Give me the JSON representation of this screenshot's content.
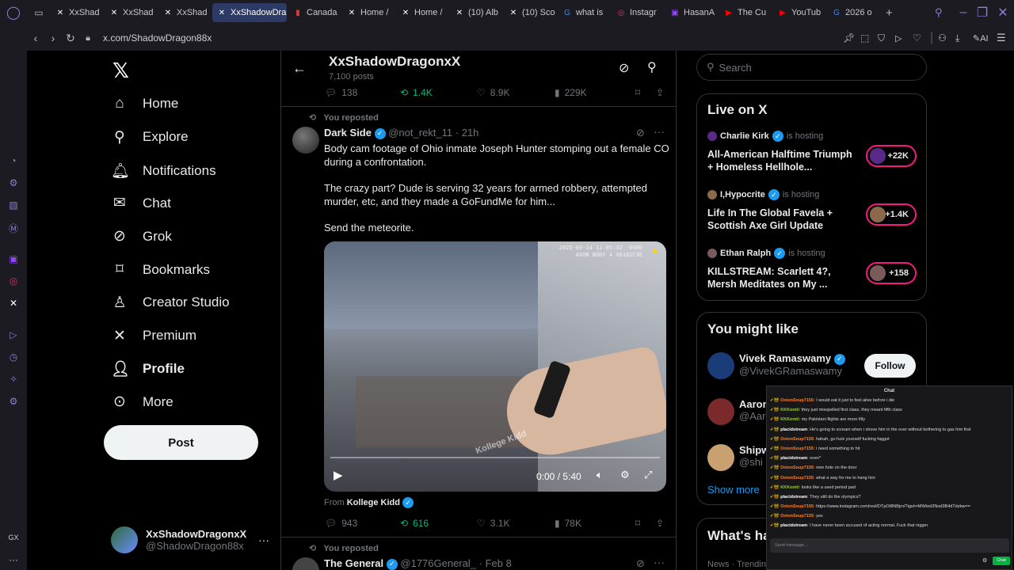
{
  "browser": {
    "tabs": [
      {
        "label": "XxShad",
        "icon": "x-logo-icon",
        "active": false
      },
      {
        "label": "XxShad",
        "icon": "x-logo-icon",
        "active": false
      },
      {
        "label": "XxShad",
        "icon": "x-logo-icon",
        "active": false
      },
      {
        "label": "XxShadowDra",
        "icon": "x-logo-icon",
        "active": true
      },
      {
        "label": "Canada",
        "icon": "bookmark-icon",
        "active": false
      },
      {
        "label": "Home /",
        "icon": "x-logo-icon",
        "active": false
      },
      {
        "label": "Home /",
        "icon": "x-logo-icon",
        "active": false
      },
      {
        "label": "(10) Alb",
        "icon": "x-logo-icon",
        "active": false
      },
      {
        "label": "(10) Sco",
        "icon": "x-logo-icon",
        "active": false
      },
      {
        "label": "what is",
        "icon": "google-icon",
        "active": false
      },
      {
        "label": "Instagr",
        "icon": "instagram-icon",
        "active": false
      },
      {
        "label": "HasanA",
        "icon": "twitch-icon",
        "active": false
      },
      {
        "label": "The Cu",
        "icon": "youtube-icon",
        "active": false
      },
      {
        "label": "YouTub",
        "icon": "youtube-icon",
        "active": false
      },
      {
        "label": "2026 o",
        "icon": "google-icon",
        "active": false
      }
    ],
    "url": "x.com/ShadowDragon88x",
    "ai_label": "AI"
  },
  "sidebar": {
    "items": [
      {
        "label": "Home",
        "icon": "home-icon"
      },
      {
        "label": "Explore",
        "icon": "search-icon"
      },
      {
        "label": "Notifications",
        "icon": "bell-icon"
      },
      {
        "label": "Chat",
        "icon": "mail-icon"
      },
      {
        "label": "Grok",
        "icon": "grok-icon"
      },
      {
        "label": "Bookmarks",
        "icon": "bookmark-icon"
      },
      {
        "label": "Creator Studio",
        "icon": "creator-studio-icon"
      },
      {
        "label": "Premium",
        "icon": "x-logo-icon"
      },
      {
        "label": "Profile",
        "icon": "person-icon"
      },
      {
        "label": "More",
        "icon": "more-circle-icon"
      }
    ],
    "post_label": "Post",
    "account": {
      "name": "XxShadowDragonxX",
      "handle": "@ShadowDragon88x"
    }
  },
  "profile_header": {
    "name": "XxShadowDragonxX",
    "posts": "7,100 posts"
  },
  "top_stats": {
    "replies": "138",
    "reposts": "1.4K",
    "likes": "8.9K",
    "views": "229K"
  },
  "post": {
    "repost_label": "You reposted",
    "author": "Dark Side",
    "handle": "@not_rekt_11",
    "time": "21h",
    "text1": "Body cam footage of Ohio inmate Joseph Hunter stomping out a female CO during a confrontation.",
    "text2": "The crazy part? Dude is serving 32 years for armed robbery, attempted murder, etc, and they made a GoFundMe for him...",
    "text3": "Send the meteorite.",
    "video": {
      "time": "0:00 / 5:40",
      "timestamp_overlay": "2025-03-14 11:05:32 -0400",
      "device_overlay": "AXON BODY 4 X6102C3E",
      "watermark": "Kollege Kidd"
    },
    "from_label": "From",
    "from_name": "Kollege Kidd",
    "stats": {
      "replies": "943",
      "reposts": "616",
      "likes": "3.1K",
      "views": "78K"
    }
  },
  "next_post": {
    "repost_label": "You reposted",
    "author": "The General",
    "handle": "@1776General_",
    "time": "Feb 8"
  },
  "right": {
    "search_placeholder": "Search",
    "live_title": "Live on X",
    "live": [
      {
        "host": "Charlie Kirk",
        "hosting": "is hosting",
        "title": "All-American Halftime Triumph + Homeless Hellhole...",
        "count": "+22K"
      },
      {
        "host": "I,Hypocrite",
        "hosting": "is hosting",
        "title": "Life In The Global Favela + Scottish Axe Girl Update",
        "count": "+1.4K"
      },
      {
        "host": "Ethan Ralph",
        "hosting": "is hosting",
        "title": "KILLSTREAM: Scarlett 4?, Mersh Meditates on My ...",
        "count": "+158"
      }
    ],
    "like_title": "You might like",
    "like": [
      {
        "name": "Vivek Ramaswamy",
        "handle": "@VivekGRamaswamy",
        "follow": "Follow"
      },
      {
        "name": "Aaron",
        "handle": "@Aaro"
      },
      {
        "name": "Shipw",
        "handle": "@shi"
      }
    ],
    "show_more": "Show more",
    "whats_title": "What's ha",
    "whats_sub": "News · Trendin"
  },
  "chat": {
    "title": "Chat",
    "lines": [
      {
        "user": "OnionSoup7155",
        "color": "#ff7f24",
        "text": "I would eat it just to feel alive before i die"
      },
      {
        "user": "KKKomti",
        "color": "#9acd32",
        "text": "they just misspelled first class, they meant fifth class"
      },
      {
        "user": "KKKomti",
        "color": "#9acd32",
        "text": "my Pakistani flights are more filty"
      },
      {
        "user": "placidstream",
        "color": "#ffffff",
        "text": "He's going to scream when i shove him in the over without bothering to gas him first"
      },
      {
        "user": "OnionSoup7155",
        "color": "#ff7f24",
        "text": "hahah, go fuck yourself fucking faggot"
      },
      {
        "user": "OnionSoup7155",
        "color": "#ff7f24",
        "text": "i need something to hit"
      },
      {
        "user": "placidstream",
        "color": "#ffffff",
        "text": "oven*"
      },
      {
        "user": "OnionSoup7155",
        "color": "#ff7f24",
        "text": "new hole on the door"
      },
      {
        "user": "OnionSoup7155",
        "color": "#ff7f24",
        "text": "what a way for me to hang him"
      },
      {
        "user": "KKKomti",
        "color": "#9acd32",
        "text": "looks like a used period pad"
      },
      {
        "user": "placidstream",
        "color": "#ffffff",
        "text": "They still do the olympics?"
      },
      {
        "user": "OnionSoup7155",
        "color": "#ff7f24",
        "text": "https://www.instagram.com/reel/DTpOt8NBjrn/?igsh=MWtod2Nod3B4dTdzbw=="
      },
      {
        "user": "OnionSoup7155",
        "color": "#ff7f24",
        "text": "yes"
      },
      {
        "user": "placidstream",
        "color": "#ffffff",
        "text": "I have never been accused of acting normal. Fuck that nigger."
      }
    ],
    "input_placeholder": "Send message...",
    "send_label": "Chat"
  }
}
